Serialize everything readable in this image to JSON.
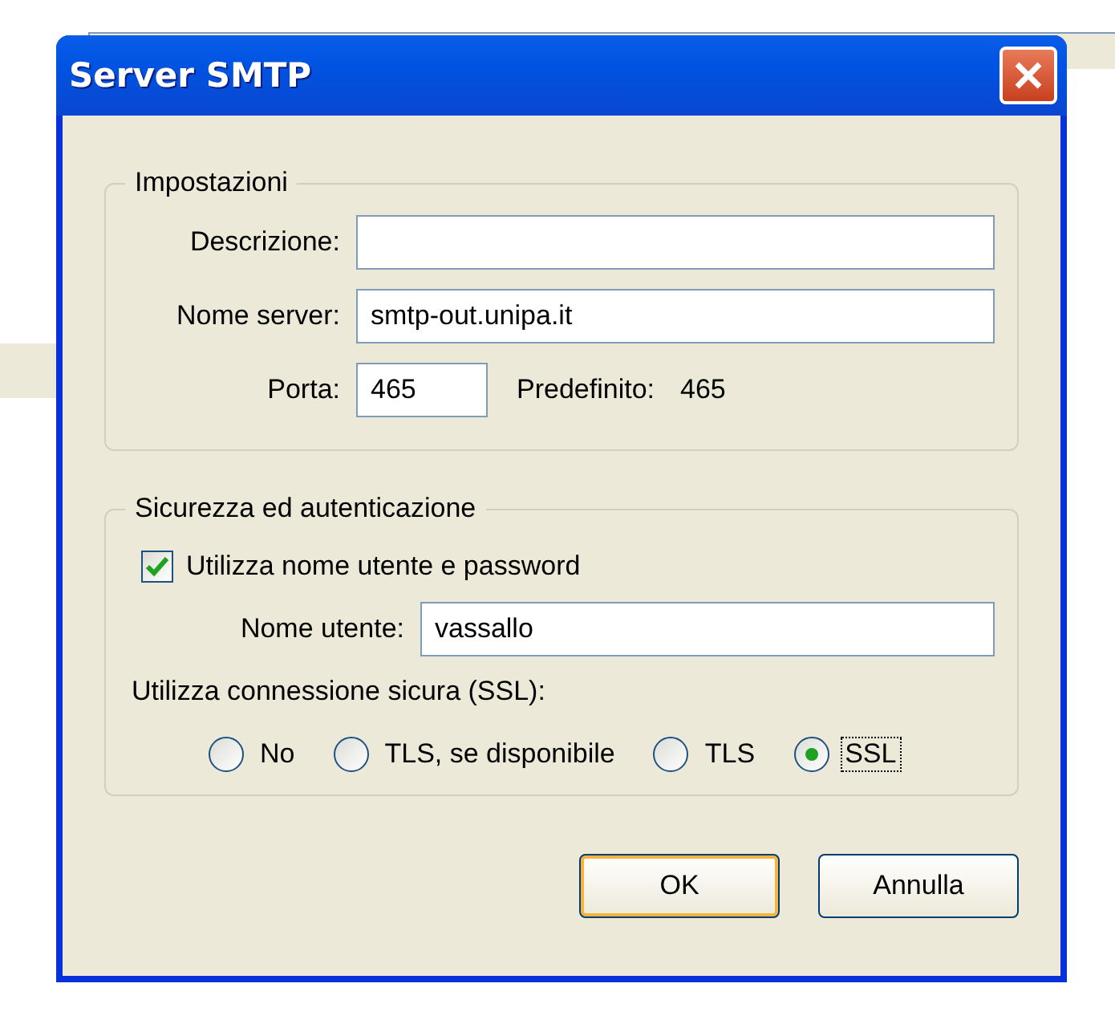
{
  "window": {
    "title": "Server SMTP"
  },
  "settings": {
    "legend": "Impostazioni",
    "fields": [
      {
        "label": "Descrizione:"
      },
      {
        "label": "Nome server:",
        "value": "smtp-out.unipa.it"
      }
    ],
    "port": {
      "label": "Porta:",
      "value": "465",
      "default_label": "Predefinito:",
      "default_value": "465"
    }
  },
  "security": {
    "legend": "Sicurezza ed autenticazione",
    "auth_checkbox": {
      "label": "Utilizza nome utente e password",
      "checked": true
    },
    "username": {
      "label": "Nome utente:",
      "value": "vassallo"
    },
    "ssl_label": "Utilizza connessione sicura (SSL):",
    "options": [
      {
        "label": "No",
        "selected": false
      },
      {
        "label": "TLS, se disponibile",
        "selected": false
      },
      {
        "label": "TLS",
        "selected": false
      },
      {
        "label": "SSL",
        "selected": true
      }
    ]
  },
  "buttons": [
    {
      "label": "OK",
      "default": true
    },
    {
      "label": "Annulla",
      "default": false
    }
  ]
}
